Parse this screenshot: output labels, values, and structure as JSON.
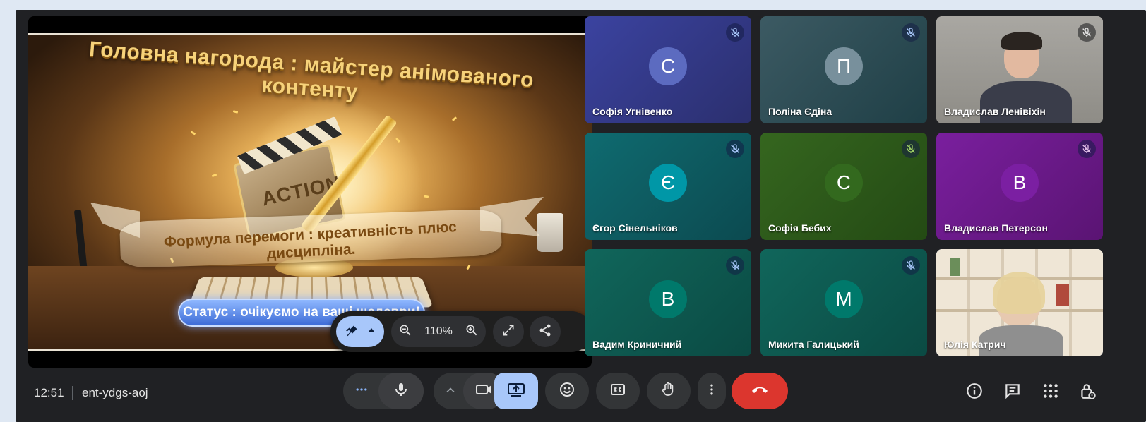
{
  "slide": {
    "title": "Головна нагорода : майстер анімованого контенту",
    "subtitle": "Формула перемоги : креативність плюс дисципліна.",
    "status": "Статус : очікуємо на ваші шедеври!",
    "clapper_text": "ACTION"
  },
  "presentation_toolbar": {
    "zoom_level": "110%",
    "icons": [
      "annotate-pen-icon",
      "caret-up-icon",
      "zoom-out-icon",
      "zoom-in-icon",
      "expand-icon",
      "share-icon"
    ]
  },
  "participants": [
    {
      "name": "Софія Угнівенко",
      "initial": "С",
      "muted": true,
      "video": false,
      "bg": "#3a3f93",
      "avatar_color": "#5c6bc0"
    },
    {
      "name": "Поліна Єдіна",
      "initial": "П",
      "muted": true,
      "video": false,
      "bg": "#3c5a63",
      "avatar_color": "#78909c"
    },
    {
      "name": "Владислав Ленівіхін",
      "initial": "",
      "muted": true,
      "video": true,
      "bg": "#8a8a88",
      "avatar_color": ""
    },
    {
      "name": "Єгор Сінельніков",
      "initial": "Є",
      "muted": true,
      "video": false,
      "bg": "#0d5e63",
      "avatar_color": "#0097a7"
    },
    {
      "name": "Софія Бебих",
      "initial": "С",
      "muted": true,
      "video": false,
      "bg": "#2f5a1e",
      "avatar_color": "#33691e"
    },
    {
      "name": "Владислав Петерсон",
      "initial": "В",
      "muted": true,
      "video": false,
      "bg": "#6a1b8a",
      "avatar_color": "#7b1fa2"
    },
    {
      "name": "Вадим Криничний",
      "initial": "В",
      "muted": true,
      "video": false,
      "bg": "#0e5a50",
      "avatar_color": "#00796b"
    },
    {
      "name": "Микита Галицький",
      "initial": "М",
      "muted": true,
      "video": false,
      "bg": "#0e5a50",
      "avatar_color": "#00796b"
    },
    {
      "name": "Юлія Катрич",
      "initial": "",
      "muted": false,
      "video": true,
      "bg": "#cfc4b2",
      "avatar_color": ""
    }
  ],
  "bottom_bar": {
    "time": "12:51",
    "meeting_code": "ent-ydgs-aoj",
    "controls": [
      "more-options-icon",
      "microphone-icon",
      "chevron-up-icon",
      "camera-icon",
      "present-screen-icon",
      "emoji-icon",
      "captions-icon",
      "raise-hand-icon",
      "more-vert-icon",
      "end-call-icon"
    ],
    "right_icons": [
      "info-icon",
      "chat-icon",
      "activities-icon",
      "host-controls-icon"
    ]
  },
  "colors": {
    "accent": "#a8c7fa",
    "end_call": "#dc362e",
    "background": "#202124",
    "page_bg": "#dfe8f3"
  }
}
